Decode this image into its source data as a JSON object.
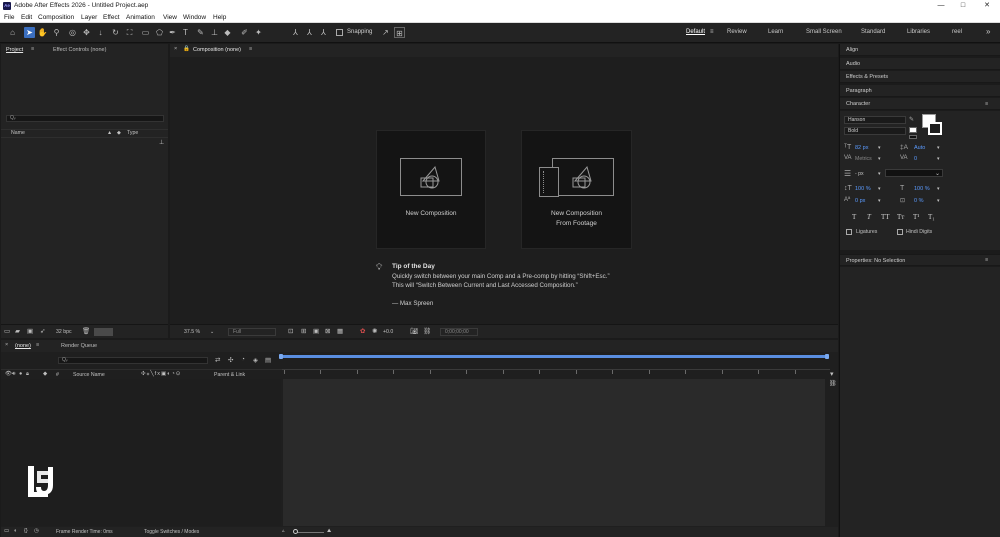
{
  "app": {
    "title": "Adobe After Effects 2026 - Untitled Project.aep",
    "icon_text": "Ae",
    "win_minimize": "—",
    "win_restore": "□",
    "win_close": "✕"
  },
  "menu": [
    "File",
    "Edit",
    "Composition",
    "Layer",
    "Effect",
    "Animation",
    "View",
    "Window",
    "Help"
  ],
  "toolbar": {
    "snapping_label": "Snapping",
    "workspaces": [
      "Default",
      "Review",
      "Learn",
      "Small Screen",
      "Standard",
      "Libraries",
      "reel"
    ],
    "active_workspace": "Default",
    "overflow": "»"
  },
  "project_panel": {
    "tab": "Project",
    "effect_controls_tab": "Effect Controls (none)",
    "search_placeholder": "Qᵥ",
    "col_name": "Name",
    "col_type": "Type",
    "bpc": "32 bpc"
  },
  "composition_panel": {
    "tab": "Composition (none)",
    "new_comp_label": "New Composition",
    "new_comp_footage_label_1": "New Composition",
    "new_comp_footage_label_2": "From Footage",
    "tip_title": "Tip of the Day",
    "tip_line1": "Quickly switch between your main Comp and a Pre-comp by hitting “Shift+Esc.”",
    "tip_line2": "This will “Switch Between Current and Last Accessed Composition.”",
    "tip_author": "— Max Spreen",
    "zoom": "37.5 %",
    "resolution": "Full",
    "exposure": "+0.0",
    "timecode": "0;00;00;00"
  },
  "right_panels": {
    "align": "Align",
    "audio": "Audio",
    "effects_presets": "Effects & Presets",
    "paragraph": "Paragraph",
    "character": "Character",
    "font_family": "Hanson",
    "font_style": "Bold",
    "font_size": "82 px",
    "leading": "Auto",
    "kerning": "Metrics",
    "tracking": "0",
    "stroke_unit": "- px",
    "vscale": "100 %",
    "hscale": "100 %",
    "baseline": "0 px",
    "tsume": "0 %",
    "format_buttons": [
      "T",
      "T",
      "TT",
      "Tт",
      "T¹",
      "T₁"
    ],
    "ligatures": "Ligatures",
    "hindi_digits": "Hindi Digits",
    "properties": "Properties: No Selection"
  },
  "timeline": {
    "tab_none": "(none)",
    "tab_render_queue": "Render Queue",
    "search_placeholder": "Qᵥ",
    "col_source_name": "Source Name",
    "col_parent_link": "Parent & Link",
    "col_hash": "#",
    "frame_render_time": "Frame Render Time: 0ms",
    "toggle_switches": "Toggle Switches / Modes"
  },
  "colors": {
    "accent": "#3b6fc0",
    "timeline_bar": "#5a8ee0",
    "panel": "#232323",
    "background": "#1b1b1b"
  }
}
